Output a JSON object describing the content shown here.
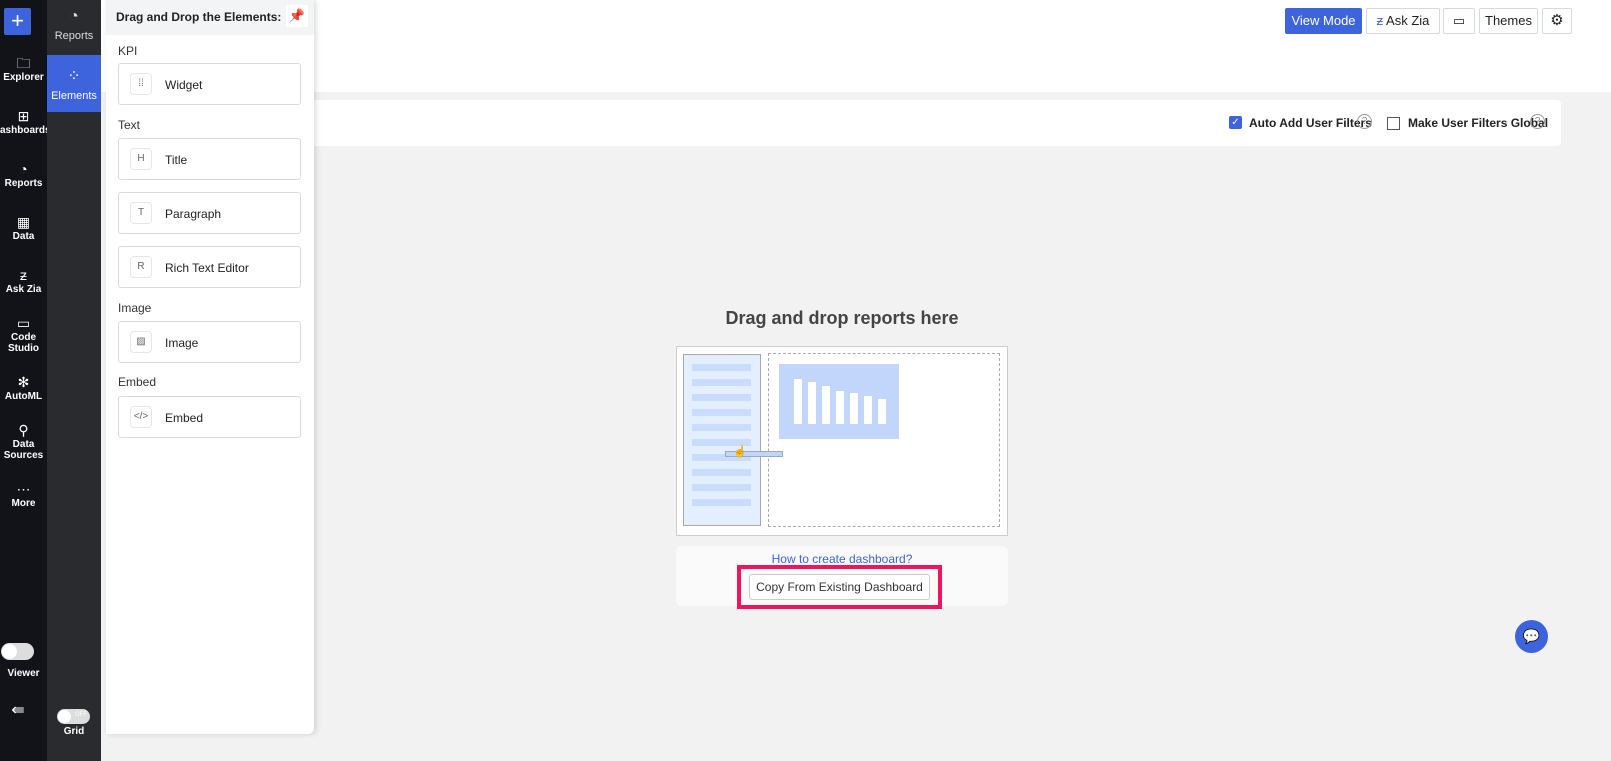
{
  "rail": {
    "add": "+",
    "items": [
      {
        "label": "Explorer",
        "icon": "folder-icon",
        "glyph": "🗀"
      },
      {
        "label": "ashboards",
        "icon": "dashboards-icon",
        "glyph": "⊞"
      },
      {
        "label": "Reports",
        "icon": "pie-chart-icon",
        "glyph": "◔"
      },
      {
        "label": "Data",
        "icon": "table-icon",
        "glyph": "▦"
      },
      {
        "label": "Ask Zia",
        "icon": "zia-icon",
        "glyph": "ƶ"
      },
      {
        "label": "Code Studio",
        "icon": "code-studio-icon",
        "glyph": "▭"
      },
      {
        "label": "AutoML",
        "icon": "automl-icon",
        "glyph": "✻"
      },
      {
        "label": "Data Sources",
        "icon": "data-sources-icon",
        "glyph": "⚲"
      },
      {
        "label": "More",
        "icon": "more-icon",
        "glyph": "⋯"
      }
    ],
    "viewer": "Viewer",
    "collapse": "⇚"
  },
  "rail2": {
    "reports": "Reports",
    "elements": "Elements",
    "grid": "Grid",
    "grid_state": "OFF"
  },
  "panel": {
    "title": "Drag and Drop the Elements:",
    "sections": {
      "kpi": "KPI",
      "text": "Text",
      "image": "Image",
      "embed": "Embed"
    },
    "items": {
      "widget": "Widget",
      "title": "Title",
      "paragraph": "Paragraph",
      "rich": "Rich Text Editor",
      "image": "Image",
      "embed": "Embed"
    }
  },
  "toolbar": {
    "view_mode": "View Mode",
    "ask_zia": "Ask Zia",
    "themes": "Themes"
  },
  "filters": {
    "auto_add": "Auto Add User Filters",
    "auto_add_checked": true,
    "global": "Make User Filters Global",
    "global_checked": false
  },
  "canvas": {
    "title": "Drag and drop reports here",
    "howto": "How to create dashboard?",
    "copy": "Copy From Existing Dashboard"
  },
  "colors": {
    "accent": "#3d63dd",
    "highlight": "#f0145a"
  }
}
